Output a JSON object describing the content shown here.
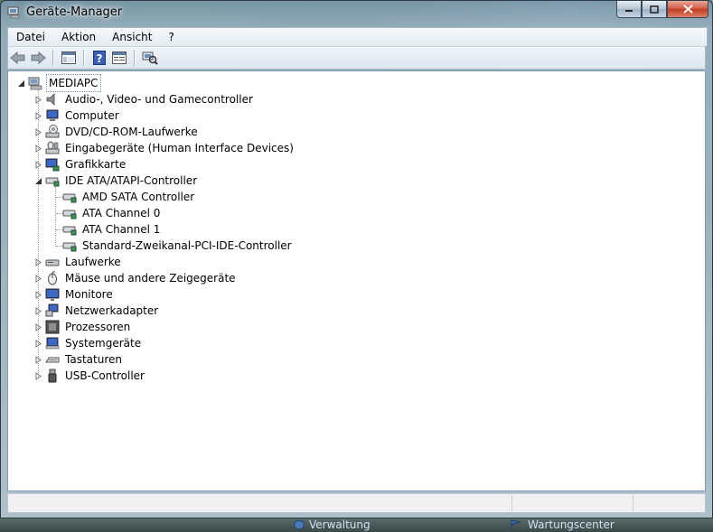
{
  "window": {
    "title": "Geräte-Manager"
  },
  "menu": [
    "Datei",
    "Aktion",
    "Ansicht",
    "?"
  ],
  "toolbar": {
    "buttons": [
      "back-icon",
      "forward-icon",
      "show-hide-tree-icon",
      "help-icon",
      "properties-icon",
      "scan-hardware-icon"
    ]
  },
  "tree": {
    "root": "MEDIAPC",
    "items": [
      {
        "label": "Audio-, Video- und Gamecontroller",
        "icon": "speaker-icon"
      },
      {
        "label": "Computer",
        "icon": "computer-icon"
      },
      {
        "label": "DVD/CD-ROM-Laufwerke",
        "icon": "dvd-icon"
      },
      {
        "label": "Eingabegeräte (Human Interface Devices)",
        "icon": "hid-icon"
      },
      {
        "label": "Grafikkarte",
        "icon": "display-adapter-icon"
      },
      {
        "label": "IDE ATA/ATAPI-Controller",
        "icon": "ide-controller-icon",
        "expanded": true
      },
      {
        "label": "Laufwerke",
        "icon": "disk-drive-icon"
      },
      {
        "label": "Mäuse und andere Zeigegeräte",
        "icon": "mouse-icon"
      },
      {
        "label": "Monitore",
        "icon": "monitor-icon"
      },
      {
        "label": "Netzwerkadapter",
        "icon": "network-adapter-icon"
      },
      {
        "label": "Prozessoren",
        "icon": "processor-icon"
      },
      {
        "label": "Systemgeräte",
        "icon": "system-device-icon"
      },
      {
        "label": "Tastaturen",
        "icon": "keyboard-icon"
      },
      {
        "label": "USB-Controller",
        "icon": "usb-icon"
      }
    ],
    "ide_children": [
      "AMD SATA Controller",
      "ATA Channel 0",
      "ATA Channel 1",
      "Standard-Zweikanal-PCI-IDE-Controller"
    ]
  },
  "taskbar": {
    "left": "Verwaltung",
    "right": "Wartungscenter"
  }
}
